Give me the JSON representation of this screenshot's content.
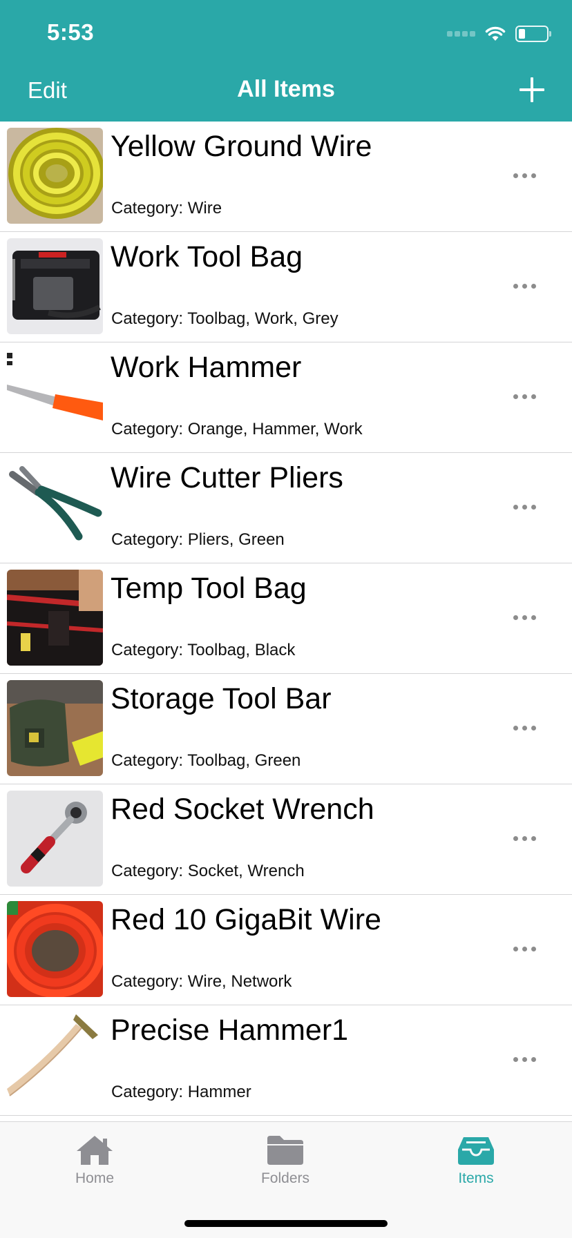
{
  "status": {
    "time": "5:53"
  },
  "nav": {
    "edit_label": "Edit",
    "title": "All Items"
  },
  "items": [
    {
      "title": "Yellow Ground Wire",
      "category": "Category: Wire",
      "image": "yellow-wire-coil"
    },
    {
      "title": "Work Tool Bag",
      "category": "Category: Toolbag, Work, Grey",
      "image": "black-tool-bag"
    },
    {
      "title": "Work Hammer",
      "category": "Category: Orange, Hammer, Work",
      "image": "orange-hammer-handle"
    },
    {
      "title": "Wire Cutter Pliers",
      "category": "Category: Pliers, Green",
      "image": "green-pliers"
    },
    {
      "title": "Temp Tool Bag",
      "category": "Category: Toolbag, Black",
      "image": "tool-belt-bag"
    },
    {
      "title": "Storage Tool Bar",
      "category": "Category: Toolbag, Green",
      "image": "green-tool-bag"
    },
    {
      "title": "Red Socket Wrench",
      "category": "Category: Socket, Wrench",
      "image": "socket-wrench"
    },
    {
      "title": "Red 10 GigaBit Wire",
      "category": "Category: Wire, Network",
      "image": "red-wire-coil"
    },
    {
      "title": "Precise Hammer1",
      "category": "Category: Hammer",
      "image": "wooden-hammer"
    }
  ],
  "tabbar": {
    "tabs": [
      {
        "label": "Home",
        "icon": "house-icon",
        "active": false
      },
      {
        "label": "Folders",
        "icon": "folder-icon",
        "active": false
      },
      {
        "label": "Items",
        "icon": "tray-icon",
        "active": true
      }
    ]
  },
  "colors": {
    "header": "#2aa8a8",
    "accent": "#2aa8a8",
    "tab_inactive": "#8e8e93",
    "separator": "#d4d4d6"
  }
}
